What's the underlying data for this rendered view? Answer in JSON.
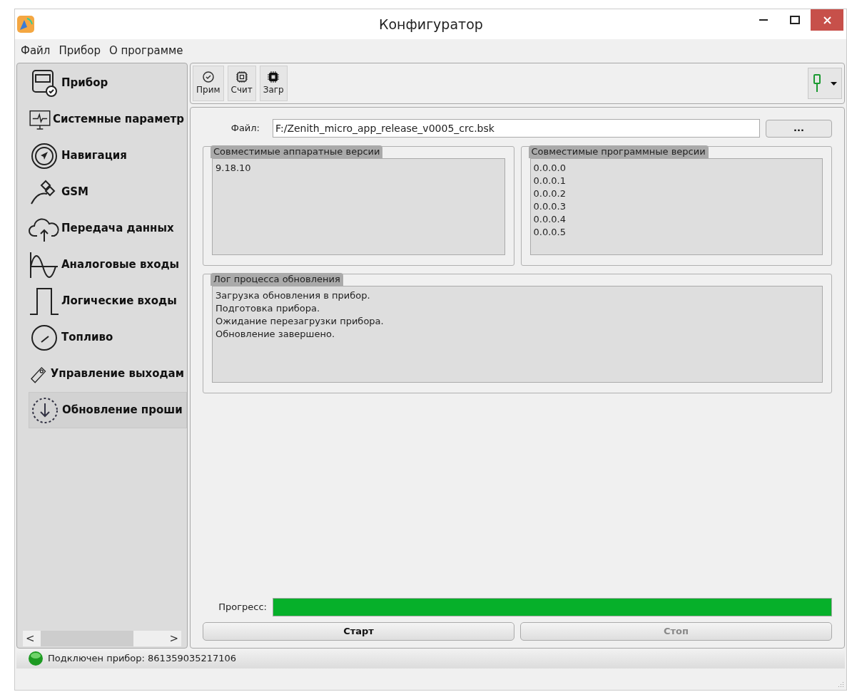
{
  "window": {
    "title": "Конфигуратор"
  },
  "menu": [
    "Файл",
    "Прибор",
    "О программе"
  ],
  "sidebar": {
    "items": [
      {
        "label": "Прибор",
        "selected": false
      },
      {
        "label": "Системные параметр",
        "selected": false
      },
      {
        "label": "Навигация",
        "selected": false
      },
      {
        "label": "GSM",
        "selected": false
      },
      {
        "label": "Передача данных",
        "selected": false
      },
      {
        "label": "Аналоговые входы",
        "selected": false
      },
      {
        "label": "Логические входы",
        "selected": false
      },
      {
        "label": "Топливо",
        "selected": false
      },
      {
        "label": "Управление выходам",
        "selected": false
      },
      {
        "label": "Обновление проши",
        "selected": true
      }
    ],
    "scroll_left": "<",
    "scroll_right": ">"
  },
  "toolbar": [
    "Прим",
    "Счит",
    "Загр"
  ],
  "file": {
    "label": "Файл:",
    "value": "F:/Zenith_micro_app_release_v0005_crc.bsk",
    "browse": "..."
  },
  "hardware_versions": {
    "title": "Совместимые аппаратные версии",
    "items": [
      "9.18.10"
    ]
  },
  "software_versions": {
    "title": "Совместимые программные версии",
    "items": [
      "0.0.0.0",
      "0.0.0.1",
      "0.0.0.2",
      "0.0.0.3",
      "0.0.0.4",
      "0.0.0.5"
    ]
  },
  "log": {
    "title": "Лог процесса обновления",
    "lines": [
      "Загрузка обновления в прибор.",
      "Подготовка прибора.",
      "Ожидание перезагрузки прибора.",
      "Обновление завершено."
    ]
  },
  "progress": {
    "label": "Прогресс:",
    "level": 1
  },
  "buttons": [
    {
      "label": "Старт",
      "disabled": false
    },
    {
      "label": "Стоп",
      "disabled": true
    }
  ],
  "status_bar": {
    "text": "Подключен прибор: 861359035217106",
    "connected": true
  }
}
